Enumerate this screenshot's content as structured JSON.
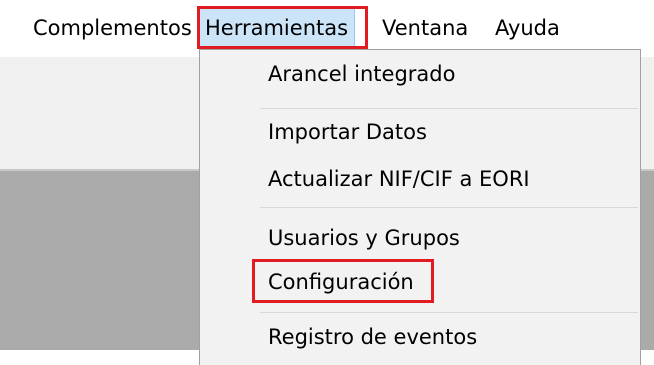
{
  "menubar": {
    "items": [
      {
        "label": "Complementos"
      },
      {
        "label": "Herramientas"
      },
      {
        "label": "Ventana"
      },
      {
        "label": "Ayuda"
      }
    ]
  },
  "dropdown": {
    "items": [
      {
        "label": "Arancel integrado"
      },
      {
        "label": "Importar Datos"
      },
      {
        "label": "Actualizar NIF/CIF a EORI"
      },
      {
        "label": "Usuarios y Grupos"
      },
      {
        "label": "Configuración"
      },
      {
        "label": "Registro de eventos"
      }
    ]
  },
  "colors": {
    "highlight": "#e11b22",
    "menu_selected": "#cce4f7",
    "menu_background": "#f2f2f2",
    "workspace": "#aaaaaa"
  }
}
